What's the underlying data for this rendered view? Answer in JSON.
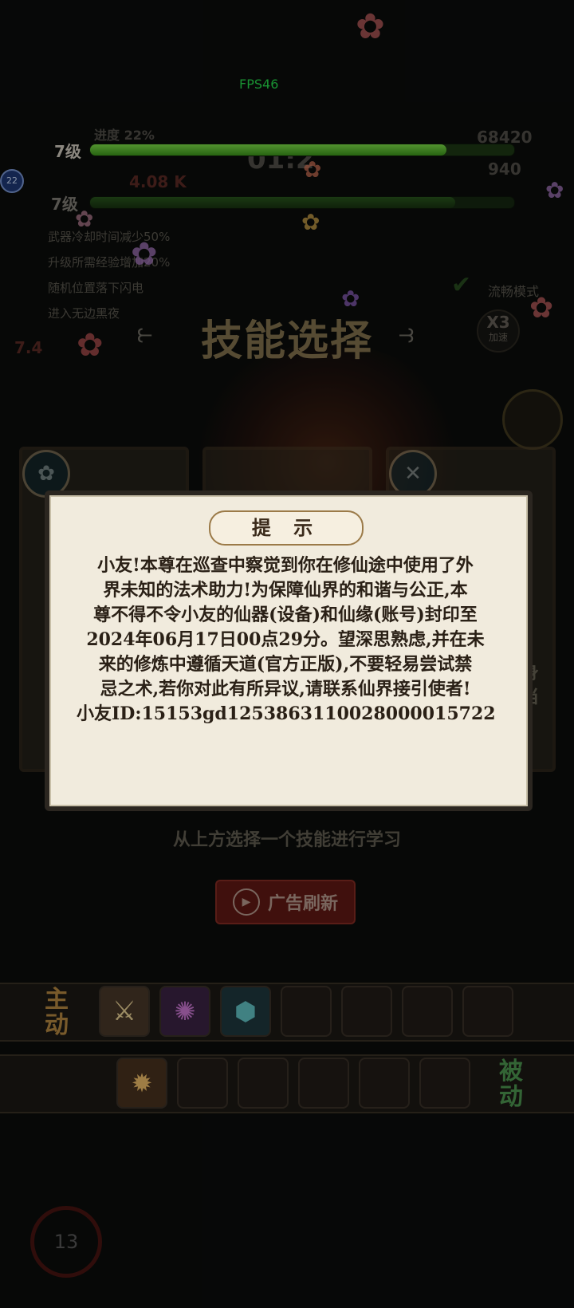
{
  "hud": {
    "fps": "FPS46",
    "player_level": "7级",
    "progress_label": "进度 22%",
    "player_xp_fraction": 0.84,
    "timer": "01:2",
    "score_top": "68420",
    "score_bottom": "940",
    "damage": "4.08 K",
    "ally_level": "7级",
    "ally_xp_fraction": 0.86,
    "side_badge": "22",
    "smooth_mode": "流畅模式",
    "speed_label": "X3",
    "speed_sub": "加速",
    "side_text": "7.4"
  },
  "buffs": [
    "武器冷却时间减少50%",
    "升级所需经验增加20%",
    "随机位置落下闪电",
    "进入无边黑夜"
  ],
  "skill_select": {
    "title": "技能选择",
    "hint": "从上方选择一个技能进行学习",
    "refresh_button": "广告刷新",
    "right_card_fragment_1": "身",
    "right_card_fragment_2": "当"
  },
  "active_label": "主\n动",
  "passive_label": "被\n动",
  "cooldown_number": "13",
  "dialog": {
    "title": "提 示",
    "lines": [
      "小友!本尊在巡查中察觉到你在修仙途中使用了外",
      "界未知的法术助力!为保障仙界的和谐与公正,本",
      "尊不得不令小友的仙器(设备)和仙缘(账号)封印至",
      "2024年06月17日00点29分。望深思熟虑,并在未",
      "来的修炼中遵循天道(官方正版),不要轻易尝试禁",
      "忌之术,若你对此有所异议,请联系仙界接引使者!",
      "小友ID:15153gd1253863110028000015722"
    ]
  },
  "colors": {
    "xp_green": "#5fc634",
    "dialog_paper": "#f1ebdd",
    "ad_red": "#7a1c16",
    "fps_green": "#27e04e"
  }
}
